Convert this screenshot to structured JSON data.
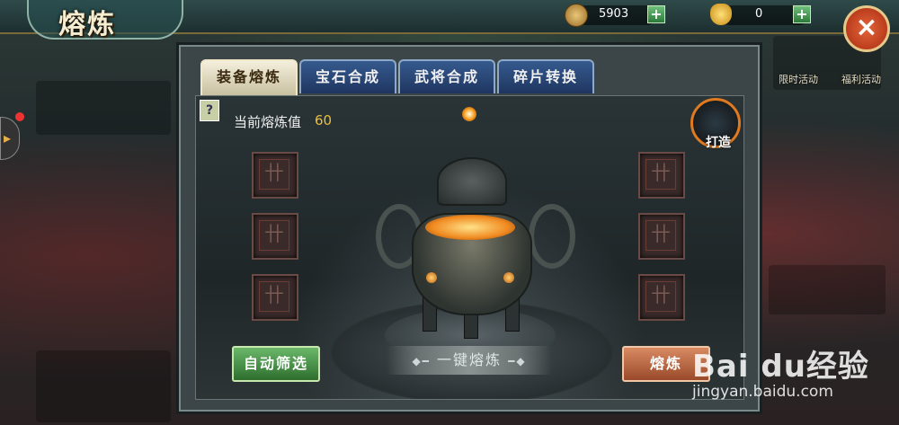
{
  "header": {
    "title": "熔炼",
    "coins": "5903",
    "ingots": "0",
    "plus_label": "+",
    "close_label": "×"
  },
  "tabs": [
    {
      "label": "装备熔炼",
      "active": true
    },
    {
      "label": "宝石合成",
      "active": false
    },
    {
      "label": "武将合成",
      "active": false
    },
    {
      "label": "碎片转换",
      "active": false
    }
  ],
  "smelting": {
    "help_label": "?",
    "meter_label": "当前熔炼值",
    "meter_value": "60",
    "forge_label": "打造",
    "auto_filter_label": "自动筛选",
    "one_click_label": "一键熔炼",
    "smelt_label": "熔炼",
    "slot_glyph": "卄"
  },
  "background": {
    "right_labels": [
      "限时活动",
      "福利活动"
    ]
  },
  "watermark": {
    "main": "Bai du经验",
    "sub": "jingyan.baidu.com"
  }
}
